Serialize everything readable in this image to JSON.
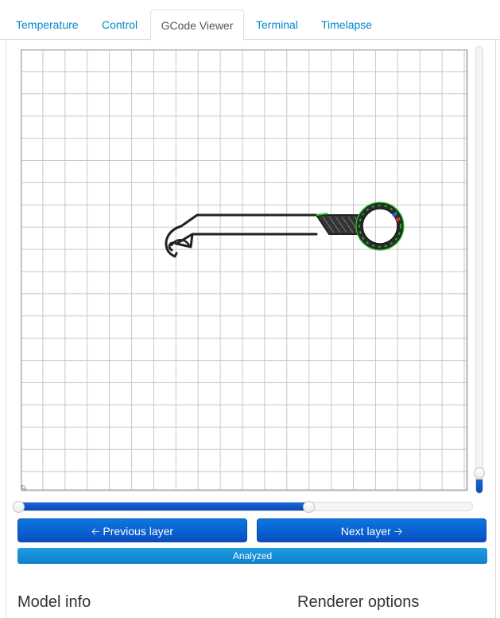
{
  "tabs": [
    {
      "label": "Temperature"
    },
    {
      "label": "Control"
    },
    {
      "label": "GCode Viewer",
      "active": true
    },
    {
      "label": "Terminal"
    },
    {
      "label": "Timelapse"
    }
  ],
  "viewer": {
    "grid_color": "#c8c8c8",
    "border_color": "#b0b0b0",
    "origin_icon": "origin-marker-icon",
    "print_path_color": "#222222",
    "infill_color": "#333333",
    "travel_color": "#22cc22"
  },
  "layer_slider": {
    "value_fraction": 0.03
  },
  "progress_slider": {
    "value_fraction": 0.64
  },
  "buttons": {
    "prev_label": "Previous layer",
    "prev_icon": "arrow-left-icon",
    "next_label": "Next layer",
    "next_icon": "arrow-right-icon"
  },
  "status": {
    "label": "Analyzed"
  },
  "sections": {
    "model_info": "Model info",
    "renderer_options": "Renderer options"
  },
  "colors": {
    "accent": "#0a5fd6",
    "tab_link": "#0088cc",
    "status_bar": "#1a92d6"
  }
}
